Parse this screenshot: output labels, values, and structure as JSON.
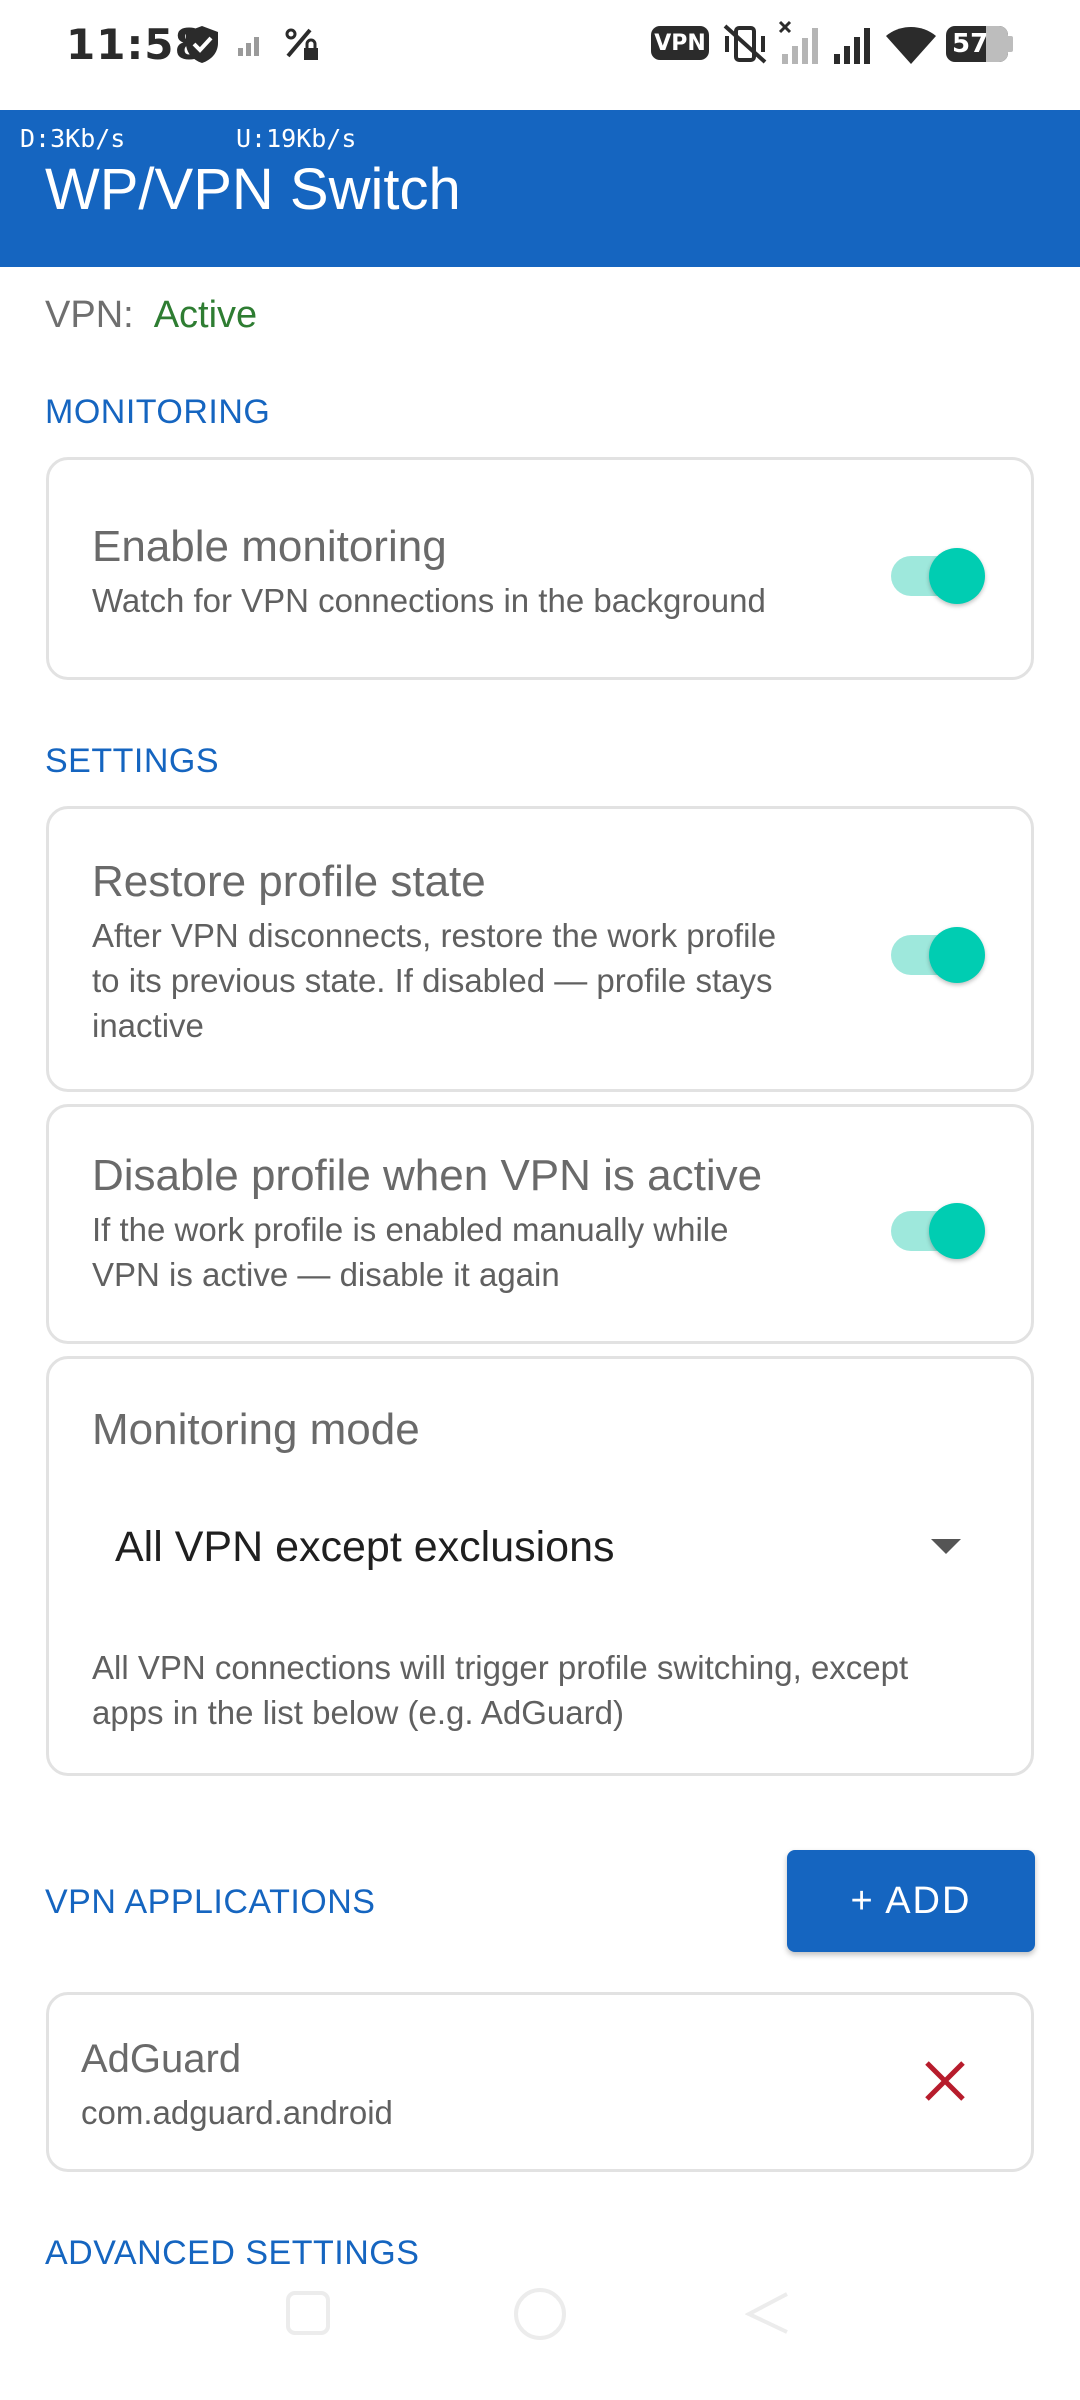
{
  "status_bar": {
    "time": "11:58",
    "vpn_badge": "VPN",
    "battery": "57",
    "icons": [
      "shield-check-icon",
      "signal-small-icon",
      "data-saver-icon",
      "vpn-badge-icon",
      "vibrate-off-icon",
      "no-signal-icon",
      "signal-icon",
      "wifi-icon",
      "battery-icon"
    ]
  },
  "app_bar": {
    "download_speed": "D:3Kb/s",
    "upload_speed": "U:19Kb/s",
    "title": "WP/VPN Switch"
  },
  "vpn_status": {
    "label": "VPN:",
    "value": "Active"
  },
  "monitoring": {
    "header": "MONITORING",
    "enable": {
      "title": "Enable monitoring",
      "description": "Watch for VPN connections in the background",
      "enabled": true
    }
  },
  "settings": {
    "header": "SETTINGS",
    "restore_profile": {
      "title": "Restore profile state",
      "description_lines": [
        "After VPN disconnects, restore the work profile",
        "to its previous state. If disabled — profile stays",
        "inactive"
      ],
      "enabled": true
    },
    "disable_profile": {
      "title": "Disable profile when VPN is active",
      "description_lines": [
        "If the work profile is enabled manually while",
        "VPN is active — disable it again"
      ],
      "enabled": true
    },
    "monitoring_mode": {
      "title": "Monitoring mode",
      "selected": "All VPN except exclusions",
      "description_lines": [
        "All VPN connections will trigger profile switching, except",
        "apps in the list below (e.g. AdGuard)"
      ]
    }
  },
  "vpn_applications": {
    "header": "VPN APPLICATIONS",
    "add_label": "+ ADD",
    "items": [
      {
        "name": "AdGuard",
        "package": "com.adguard.android"
      }
    ]
  },
  "advanced": {
    "header": "ADVANCED SETTINGS"
  },
  "colors": {
    "primary": "#1565c0",
    "active_status": "#2e7d32",
    "toggle_thumb": "#00cdb2",
    "toggle_track": "#9ee8dc",
    "remove": "#b71c2c"
  }
}
